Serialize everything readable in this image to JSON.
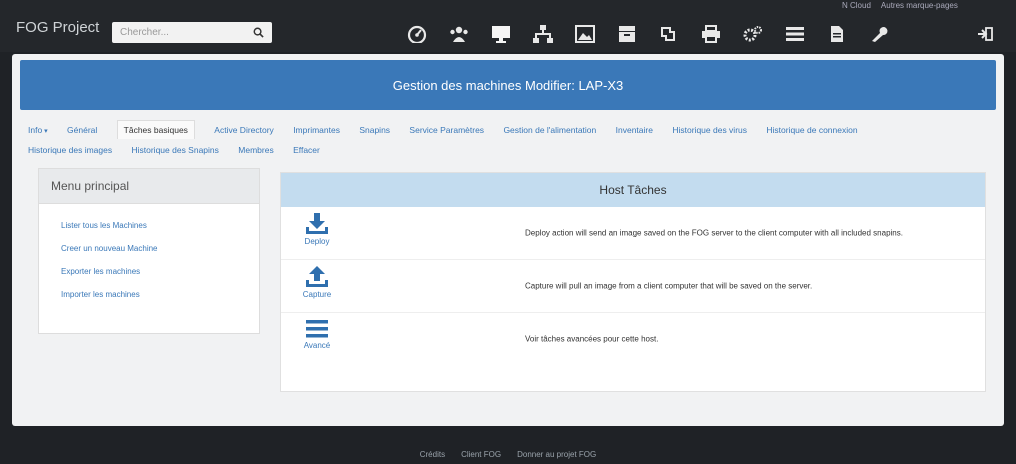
{
  "navbar": {
    "brand": "FOG Project",
    "search_placeholder": "Chercher...",
    "icons": [
      "dashboard-icon",
      "users-icon",
      "monitor-icon",
      "network-icon",
      "image-icon",
      "storage-icon",
      "snapins-icon",
      "printer-icon",
      "settings-icon",
      "list-icon",
      "report-icon",
      "wrench-icon"
    ],
    "bookmarks": [
      "N Cloud",
      "Autres marque-pages"
    ]
  },
  "header": {
    "title": "Gestion des machines Modifier: LAP-X3"
  },
  "tabs": [
    {
      "label": "Info"
    },
    {
      "label": "Général"
    },
    {
      "label": "Tâches basiques"
    },
    {
      "label": "Active Directory"
    },
    {
      "label": "Imprimantes"
    },
    {
      "label": "Snapins"
    },
    {
      "label": "Service Paramètres"
    },
    {
      "label": "Gestion de l'alimentation"
    },
    {
      "label": "Inventaire"
    },
    {
      "label": "Historique des virus"
    },
    {
      "label": "Historique de connexion"
    },
    {
      "label": "Historique des images"
    },
    {
      "label": "Historique des Snapins"
    },
    {
      "label": "Membres"
    },
    {
      "label": "Effacer"
    }
  ],
  "menu": {
    "title": "Menu principal",
    "items": [
      {
        "label": "Lister tous les Machines"
      },
      {
        "label": "Creer un nouveau Machine"
      },
      {
        "label": "Exporter les machines"
      },
      {
        "label": "Importer les machines"
      }
    ]
  },
  "panel": {
    "title": "Host Tâches",
    "tasks": [
      {
        "label": "Deploy",
        "icon": "download-icon",
        "description": "Deploy action will send an image saved on the FOG server to the client computer with all included snapins."
      },
      {
        "label": "Capture",
        "icon": "upload-icon",
        "description": "Capture will pull an image from a client computer that will be saved on the server."
      },
      {
        "label": "Avancé",
        "icon": "menu-icon",
        "description": "Voir tâches avancées pour cette host."
      }
    ]
  },
  "footer": {
    "links": [
      "Crédits",
      "Client FOG",
      "Donner au projet FOG"
    ]
  },
  "colors": {
    "accent": "#3a78b8",
    "navbar": "#24272b",
    "panel_header": "#c3dcef",
    "icon_blue": "#2f6fae"
  }
}
